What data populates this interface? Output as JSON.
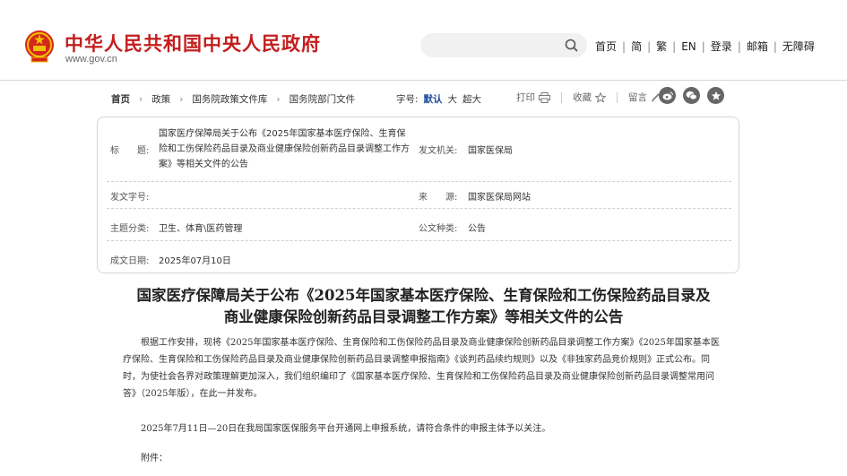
{
  "header": {
    "site_title": "中华人民共和国中央人民政府",
    "site_domain": "www.gov.cn",
    "search_placeholder": "",
    "nav": [
      "首页",
      "简",
      "繁",
      "EN",
      "登录",
      "邮箱",
      "无障碍"
    ]
  },
  "breadcrumb": {
    "items": [
      "首页",
      "政策",
      "国务院政策文件库",
      "国务院部门文件"
    ]
  },
  "font_size": {
    "label": "字号:",
    "options": [
      "默认",
      "大",
      "超大"
    ],
    "selected": "默认"
  },
  "tools": {
    "print": "打印",
    "favorite": "收藏",
    "comment": "留言"
  },
  "share_icons": [
    "weibo-icon",
    "wechat-icon",
    "qzone-icon"
  ],
  "info": {
    "title_label": "标　　题:",
    "title_value": "国家医疗保障局关于公布《2025年国家基本医疗保险、生育保险和工伤保险药品目录及商业健康保险创新药品目录调整工作方案》等相关文件的公告",
    "issuer_label": "发文机关:",
    "issuer_value": "国家医保局",
    "doc_no_label": "发文字号:",
    "doc_no_value": "",
    "source_label": "来　　源:",
    "source_value": "国家医保局网站",
    "category_label": "主题分类:",
    "category_value": "卫生、体育\\医药管理",
    "doc_type_label": "公文种类:",
    "doc_type_value": "公告",
    "date_label": "成文日期:",
    "date_value": "2025年07月10日"
  },
  "article": {
    "title_line1": "国家医疗保障局关于公布《2025年国家基本医疗保险、生育保险和工伤保险药品目录及",
    "title_line2": "商业健康保险创新药品目录调整工作方案》等相关文件的公告",
    "para1": "根据工作安排，现将《2025年国家基本医疗保险、生育保险和工伤保险药品目录及商业健康保险创新药品目录调整工作方案》《2025年国家基本医疗保险、生育保险和工伤保险药品目录及商业健康保险创新药品目录调整申报指南》《谈判药品续约规则》以及《非独家药品竞价规则》正式公布。同时，为使社会各界对政策理解更加深入，我们组织编印了《国家基本医疗保险、生育保险和工伤保险药品目录及商业健康保险创新药品目录调整常用问答》（2025年版），在此一并发布。",
    "para2": "2025年7月11日—20日在我局国家医保服务平台开通网上申报系统，请符合条件的申报主体予以关注。",
    "para3": "附件："
  },
  "colors": {
    "brand_red": "#c21e1e",
    "active_blue": "#1f4f9b"
  }
}
